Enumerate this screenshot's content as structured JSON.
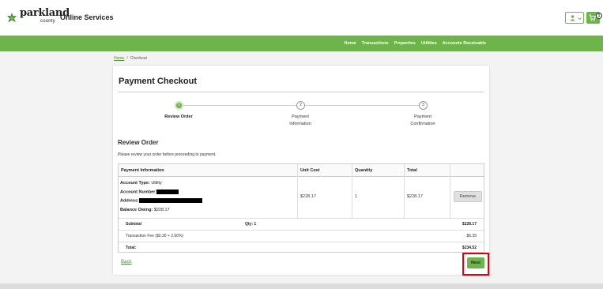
{
  "header": {
    "logo_word": "parkland",
    "logo_sub": "county",
    "site_title": "Online Services",
    "cart_count": "1"
  },
  "nav": {
    "items": [
      {
        "label": "Home"
      },
      {
        "label": "Transactions"
      },
      {
        "label": "Properties"
      },
      {
        "label": "Utilities"
      },
      {
        "label": "Accounts Receivable"
      }
    ]
  },
  "breadcrumb": {
    "home": "Home",
    "separator": "/",
    "current": "Checkout"
  },
  "page": {
    "title": "Payment Checkout"
  },
  "steps": [
    {
      "number": "1",
      "label": "Review Order",
      "active": true
    },
    {
      "number": "2",
      "label_line1": "Payment",
      "label_line2": "Information",
      "active": false
    },
    {
      "number": "3",
      "label_line1": "Payment",
      "label_line2": "Confirmation",
      "active": false
    }
  ],
  "review": {
    "heading": "Review Order",
    "intro": "Please review your order before proceeding to payment."
  },
  "table": {
    "headers": {
      "payment_info": "Payment Information",
      "unit_cost": "Unit Cost",
      "quantity": "Quantity",
      "total": "Total"
    },
    "row": {
      "account_type_label": "Account Type:",
      "account_type_value": "Utility",
      "account_number_label": "Account Number:",
      "address_label": "Address:",
      "balance_label": "Balance Owing:",
      "balance_value": "$228.17",
      "unit_cost": "$228.17",
      "quantity": "1",
      "total": "$228.17",
      "remove_label": "Remove"
    },
    "summary": {
      "subtotal_label": "Subtotal",
      "qty_text": "Qty: 1",
      "subtotal_value": "$228.17",
      "fee_label": "Transaction Fee ($0.30 + 2.60%)",
      "fee_value": "$6.35",
      "total_label": "Total:",
      "total_value": "$234.52"
    }
  },
  "actions": {
    "back_label": "Back",
    "next_label": "Next"
  },
  "colors": {
    "brand_green": "#6db54a",
    "highlight_red": "#e0000b"
  },
  "icons": [
    "parkland-leaf-logo",
    "user-icon",
    "chevron-down-icon",
    "cart-icon"
  ]
}
